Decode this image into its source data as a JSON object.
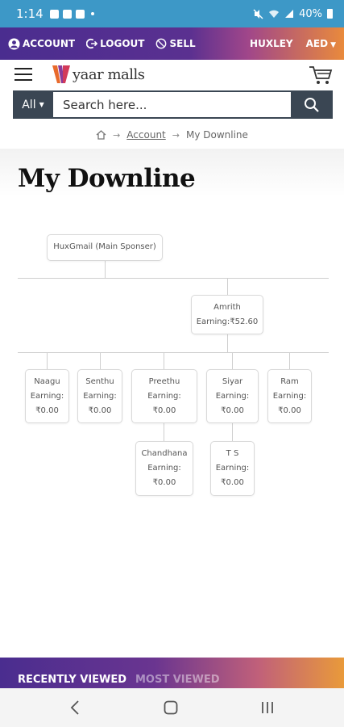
{
  "status": {
    "time": "1:14",
    "battery": "40%"
  },
  "topbar": {
    "account_label": "ACCOUNT",
    "logout_label": "LOGOUT",
    "sell_label": "SELL",
    "user_label": "HUXLEY",
    "currency_label": "AED"
  },
  "header": {
    "logo_text": "yaar malls"
  },
  "search": {
    "category_label": "All",
    "placeholder": "Search here..."
  },
  "breadcrumb": {
    "account": "Account",
    "current": "My Downline"
  },
  "page": {
    "title": "My Downline"
  },
  "tree": {
    "root": {
      "name": "HuxGmail (Main Sponser)"
    },
    "level1": [
      {
        "name": "Amrith",
        "earning": "Earning:₹52.60"
      }
    ],
    "level2": [
      {
        "name": "Naagu",
        "earning_label": "Earning:",
        "amount": "₹0.00"
      },
      {
        "name": "Senthu",
        "earning_label": "Earning:",
        "amount": "₹0.00"
      },
      {
        "name": "Preethu",
        "earning_label": "Earning:",
        "amount": "₹0.00"
      },
      {
        "name": "Siyar",
        "earning_label": "Earning:",
        "amount": "₹0.00"
      },
      {
        "name": "Ram",
        "earning_label": "Earning:",
        "amount": "₹0.00"
      }
    ],
    "level3": [
      {
        "name": "Chandhana",
        "earning_label": "Earning:",
        "amount": "₹0.00"
      },
      {
        "name": "T S",
        "earning_label": "Earning:",
        "amount": "₹0.00"
      }
    ]
  },
  "bottom_tabs": {
    "recently_viewed": "RECENTLY VIEWED",
    "most_viewed": "MOST VIEWED"
  },
  "colors": {
    "header_dark": "#3a4653",
    "gradient_start": "#4a2d8f",
    "gradient_end": "#e98a3c",
    "statusbar": "#3d98c7"
  }
}
